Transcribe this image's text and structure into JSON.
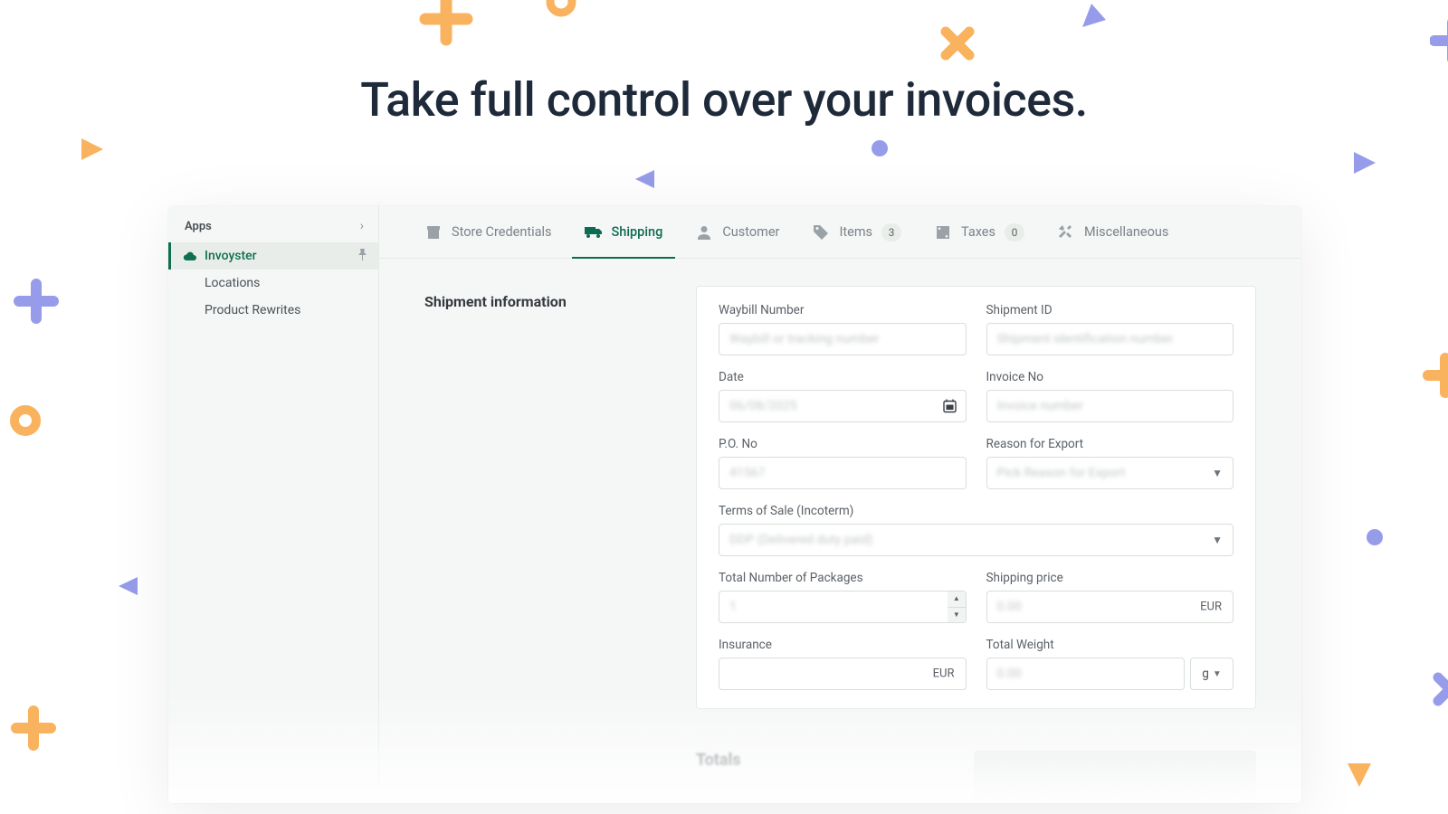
{
  "headline": "Take full control over your invoices.",
  "sidebar": {
    "section_label": "Apps",
    "items": [
      {
        "label": "Invoyster",
        "active": true
      },
      {
        "label": "Locations",
        "active": false
      },
      {
        "label": "Product Rewrites",
        "active": false
      }
    ]
  },
  "tabs": {
    "store": "Store Credentials",
    "shipping": "Shipping",
    "customer": "Customer",
    "items": {
      "label": "Items",
      "count": "3"
    },
    "taxes": {
      "label": "Taxes",
      "count": "0"
    },
    "misc": "Miscellaneous"
  },
  "section": {
    "shipment_info_title": "Shipment information",
    "totals_title": "Totals"
  },
  "form": {
    "waybill": {
      "label": "Waybill Number",
      "placeholder": "Waybill or tracking number"
    },
    "shipment": {
      "label": "Shipment ID",
      "placeholder": "Shipment identification number"
    },
    "date": {
      "label": "Date",
      "value": "06/08/2025"
    },
    "invoice": {
      "label": "Invoice No",
      "placeholder": "Invoice number"
    },
    "pono": {
      "label": "P.O. No",
      "value": "41567"
    },
    "reason": {
      "label": "Reason for Export",
      "value": "Pick Reason for Export"
    },
    "terms": {
      "label": "Terms of Sale (Incoterm)",
      "value": "DDP (Delivered duty paid)"
    },
    "packages": {
      "label": "Total Number of Packages",
      "value": "1"
    },
    "ship_price": {
      "label": "Shipping price",
      "value": "0.00",
      "currency": "EUR"
    },
    "insurance": {
      "label": "Insurance",
      "currency": "EUR"
    },
    "weight": {
      "label": "Total Weight",
      "value": "0.00",
      "unit": "g"
    }
  },
  "colors": {
    "accent": "#0d6b51",
    "orange": "#f9b25e",
    "lilac": "#969cea"
  }
}
